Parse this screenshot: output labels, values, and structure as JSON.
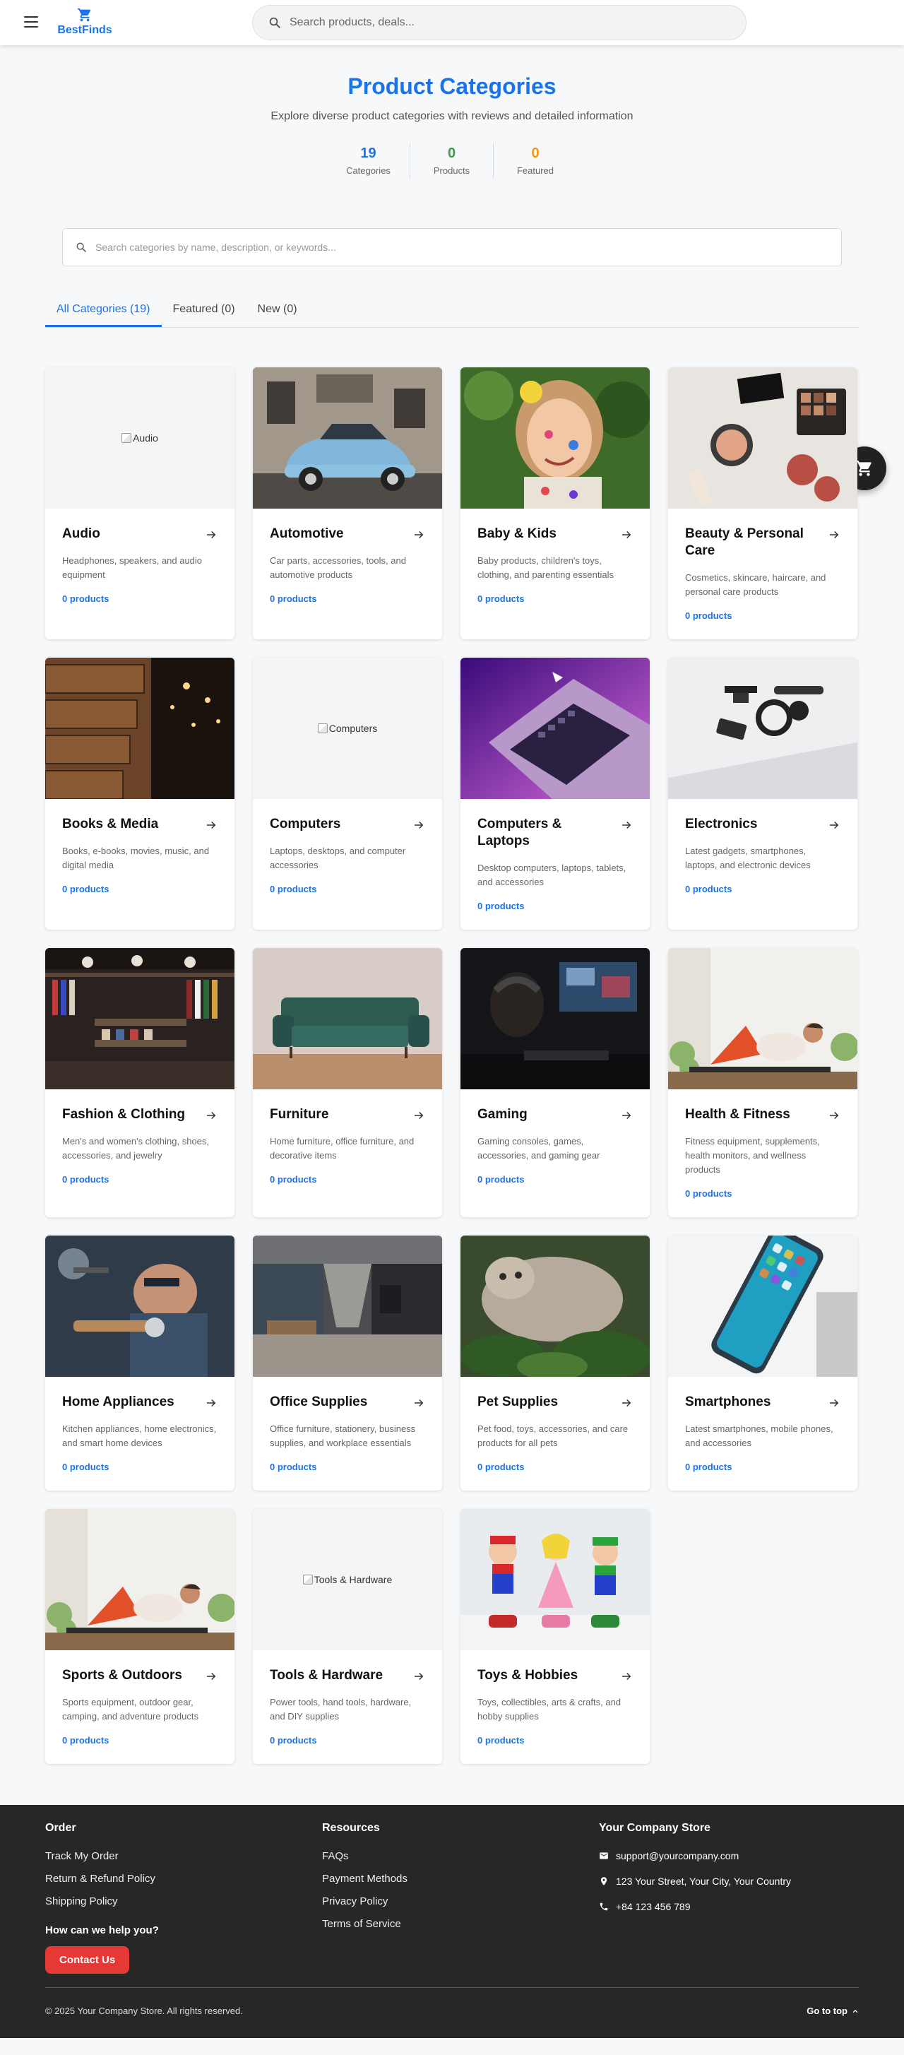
{
  "header": {
    "brand": "BestFinds",
    "search_placeholder": "Search products, deals..."
  },
  "hero": {
    "title": "Product Categories",
    "subtitle": "Explore diverse product categories with reviews and detailed information",
    "stats": [
      {
        "value": "19",
        "label": "Categories",
        "color": "#1a73e8"
      },
      {
        "value": "0",
        "label": "Products",
        "color": "#2e9e4f"
      },
      {
        "value": "0",
        "label": "Featured",
        "color": "#f29900"
      }
    ]
  },
  "category_search": {
    "placeholder": "Search categories by name, description, or keywords..."
  },
  "tabs": [
    {
      "label": "All Categories (19)",
      "active": true
    },
    {
      "label": "Featured (0)",
      "active": false
    },
    {
      "label": "New (0)",
      "active": false
    }
  ],
  "categories": [
    {
      "name": "Audio",
      "description": "Headphones, speakers, and audio equipment",
      "count": "0 products",
      "image": "broken",
      "alt": "Audio"
    },
    {
      "name": "Automotive",
      "description": "Car parts, accessories, tools, and automotive products",
      "count": "0 products",
      "image": "car"
    },
    {
      "name": "Baby & Kids",
      "description": "Baby products, children's toys, clothing, and parenting essentials",
      "count": "0 products",
      "image": "child"
    },
    {
      "name": "Beauty & Personal Care",
      "description": "Cosmetics, skincare, haircare, and personal care products",
      "count": "0 products",
      "image": "cosmetics"
    },
    {
      "name": "Books & Media",
      "description": "Books, e-books, movies, music, and digital media",
      "count": "0 products",
      "image": "library"
    },
    {
      "name": "Computers",
      "description": "Laptops, desktops, and computer accessories",
      "count": "0 products",
      "image": "broken",
      "alt": "Computers"
    },
    {
      "name": "Computers & Laptops",
      "description": "Desktop computers, laptops, tablets, and accessories",
      "count": "0 products",
      "image": "laptop"
    },
    {
      "name": "Electronics",
      "description": "Latest gadgets, smartphones, laptops, and electronic devices",
      "count": "0 products",
      "image": "gadgets"
    },
    {
      "name": "Fashion & Clothing",
      "description": "Men's and women's clothing, shoes, accessories, and jewelry",
      "count": "0 products",
      "image": "store"
    },
    {
      "name": "Furniture",
      "description": "Home furniture, office furniture, and decorative items",
      "count": "0 products",
      "image": "sofa"
    },
    {
      "name": "Gaming",
      "description": "Gaming consoles, games, accessories, and gaming gear",
      "count": "0 products",
      "image": "gaming"
    },
    {
      "name": "Health & Fitness",
      "description": "Fitness equipment, supplements, health monitors, and wellness products",
      "count": "0 products",
      "image": "fitness"
    },
    {
      "name": "Home Appliances",
      "description": "Kitchen appliances, home electronics, and smart home devices",
      "count": "0 products",
      "image": "workshop"
    },
    {
      "name": "Office Supplies",
      "description": "Office furniture, stationery, business supplies, and workplace essentials",
      "count": "0 products",
      "image": "office"
    },
    {
      "name": "Pet Supplies",
      "description": "Pet food, toys, accessories, and care products for all pets",
      "count": "0 products",
      "image": "cat"
    },
    {
      "name": "Smartphones",
      "description": "Latest smartphones, mobile phones, and accessories",
      "count": "0 products",
      "image": "phone"
    },
    {
      "name": "Sports & Outdoors",
      "description": "Sports equipment, outdoor gear, camping, and adventure products",
      "count": "0 products",
      "image": "fitness"
    },
    {
      "name": "Tools & Hardware",
      "description": "Power tools, hand tools, hardware, and DIY supplies",
      "count": "0 products",
      "image": "broken",
      "alt": "Tools & Hardware"
    },
    {
      "name": "Toys & Hobbies",
      "description": "Toys, collectibles, arts & crafts, and hobby supplies",
      "count": "0 products",
      "image": "toys"
    }
  ],
  "footer": {
    "order": {
      "heading": "Order",
      "links": [
        "Track My Order",
        "Return & Refund Policy",
        "Shipping Policy"
      ],
      "help_heading": "How can we help you?",
      "contact_button": "Contact Us"
    },
    "resources": {
      "heading": "Resources",
      "links": [
        "FAQs",
        "Payment Methods",
        "Privacy Policy",
        "Terms of Service"
      ]
    },
    "store": {
      "heading": "Your Company Store",
      "email": "support@yourcompany.com",
      "address": "123 Your Street, Your City, Your Country",
      "phone": "+84 123 456 789"
    },
    "copyright": "© 2025 Your Company Store. All rights reserved.",
    "go_top": "Go to top"
  },
  "colors": {
    "primary": "#1a73e8",
    "contact_button": "#e53935",
    "footer_bg": "#272727"
  }
}
